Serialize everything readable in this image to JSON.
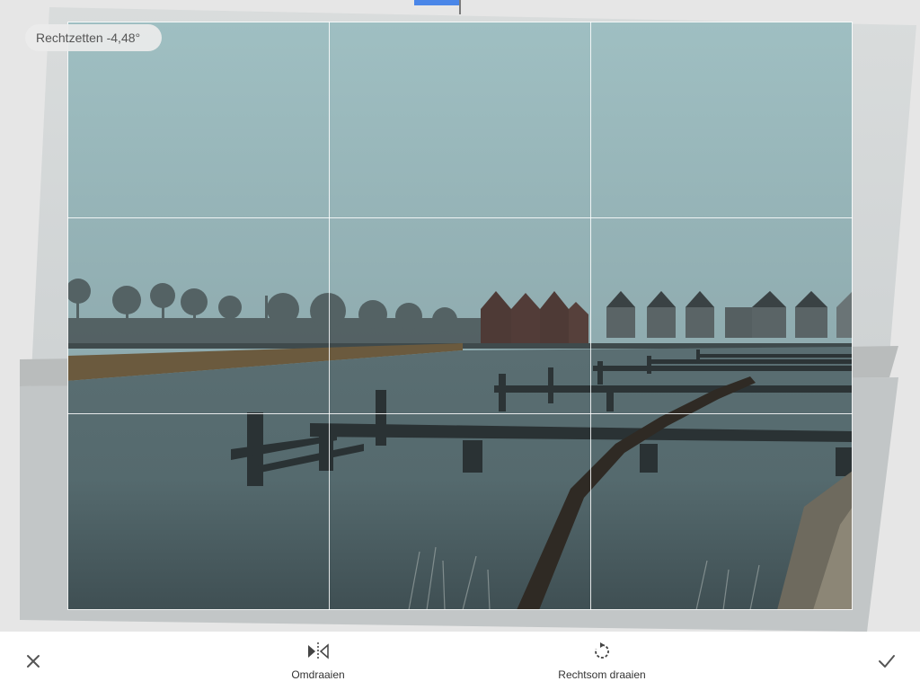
{
  "straighten": {
    "label": "Rechtzetten -4,48°"
  },
  "toolbar": {
    "cancel_icon": "close-icon",
    "flip": {
      "label": "Omdraaien",
      "icon": "flip-horizontal-icon"
    },
    "rotate": {
      "label": "Rechtsom draaien",
      "icon": "rotate-clockwise-icon"
    },
    "confirm_icon": "check-icon"
  },
  "grid": {
    "columns": 3,
    "rows": 3
  },
  "colors": {
    "accent": "#4a86e8",
    "toolbar_text": "#333333",
    "pill_background": "#ebebeb"
  }
}
